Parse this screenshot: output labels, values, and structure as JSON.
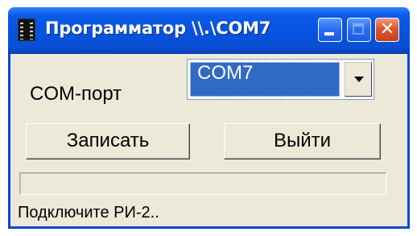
{
  "window": {
    "title": "Программатор \\\\.\\COM7"
  },
  "form": {
    "com_label": "COM-порт",
    "com_port": {
      "selected": "COM7"
    },
    "write_button": "Записать",
    "exit_button": "Выйти",
    "progress": 0,
    "status_text": "Подключите РИ-2.."
  },
  "colors": {
    "titlebar": "#0653e0",
    "selection": "#316ac5",
    "face": "#ece9d8",
    "close_button": "#e0552a"
  },
  "icons": [
    "film-app-icon",
    "minimize-icon",
    "maximize-icon",
    "close-icon",
    "dropdown-arrow-icon"
  ]
}
